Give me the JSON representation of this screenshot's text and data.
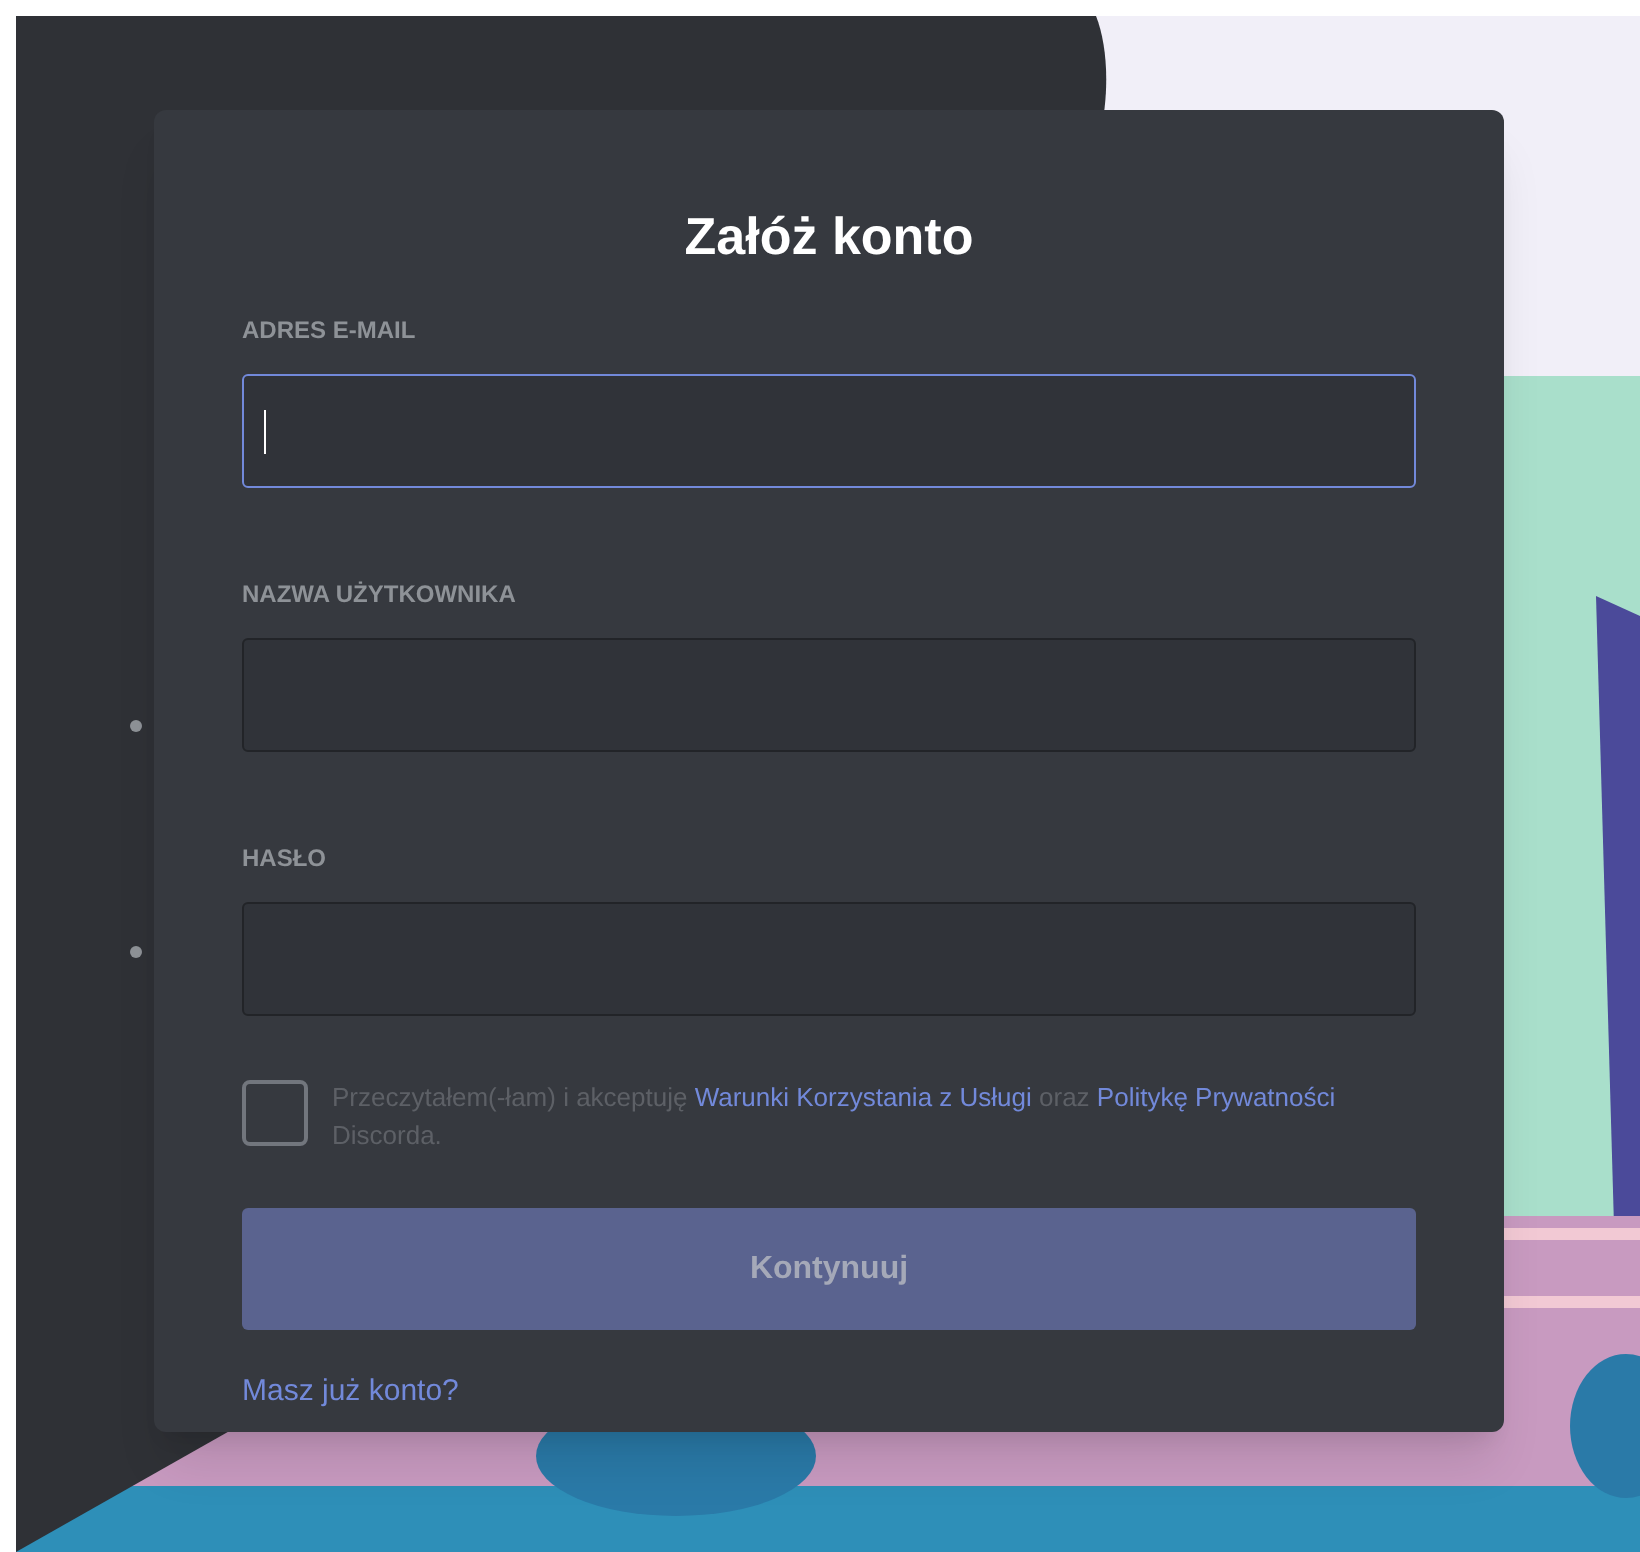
{
  "title": "Załóż konto",
  "fields": [
    {
      "label": "ADRES E-MAIL",
      "focused": true
    },
    {
      "label": "NAZWA UŻYTKOWNIKA",
      "focused": false
    },
    {
      "label": "HASŁO",
      "focused": false
    }
  ],
  "terms": {
    "checked": false,
    "parts": [
      {
        "kind": "text",
        "text": "Przeczytałem(-łam) i akceptuję "
      },
      {
        "kind": "link",
        "text": "Warunki Korzystania z Usługi"
      },
      {
        "kind": "text",
        "text": " oraz "
      },
      {
        "kind": "link",
        "text": "Politykę Prywatności"
      },
      {
        "kind": "text",
        "text": " Discorda."
      }
    ]
  },
  "submit": {
    "label": "Kontynuuj",
    "disabled": true
  },
  "login_link": "Masz już konto?"
}
